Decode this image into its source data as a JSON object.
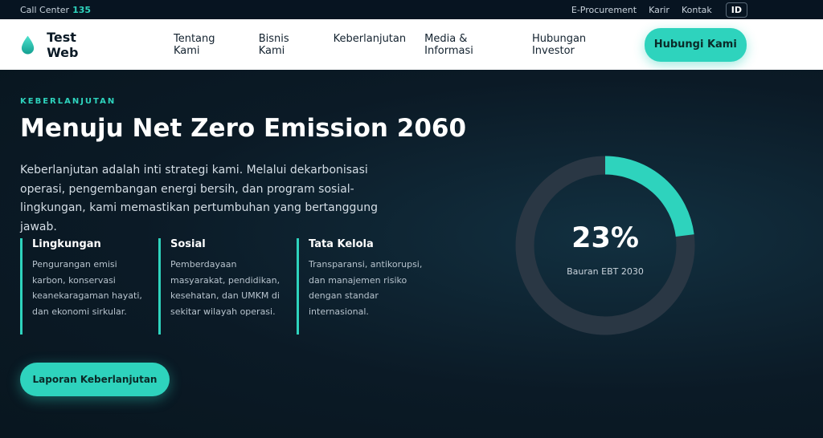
{
  "topbar": {
    "call_center_label": "Call Center",
    "call_center_number": "135",
    "links": [
      "E-Procurement",
      "Karir",
      "Kontak"
    ],
    "language": "ID"
  },
  "nav": {
    "brand": "Test Web",
    "menu": [
      "Tentang Kami",
      "Bisnis Kami",
      "Keberlanjutan",
      "Media & Informasi",
      "Hubungan Investor"
    ],
    "cta": "Hubungi Kami"
  },
  "hero": {
    "eyebrow": "KEBERLANJUTAN",
    "title": "Menuju Net Zero Emission 2060",
    "description": "Keberlanjutan adalah inti strategi kami. Melalui dekarbonisasi operasi, pengembangan energi bersih, dan program sosial-lingkungan, kami memastikan pertumbuhan yang bertanggung jawab.",
    "pillars": [
      {
        "title": "Lingkungan",
        "text": "Pengurangan emisi karbon, konservasi keanekaragaman hayati, dan ekonomi sirkular."
      },
      {
        "title": "Sosial",
        "text": "Pemberdayaan masyarakat, pendidikan, kesehatan, dan UMKM di sekitar wilayah operasi."
      },
      {
        "title": "Tata Kelola",
        "text": "Transparansi, antikorupsi, dan manajemen risiko dengan standar internasional."
      }
    ],
    "report_button": "Laporan Keberlanjutan"
  },
  "metric": {
    "value_label": "23%",
    "fraction": 0.23,
    "caption": "Bauran EBT 2030"
  },
  "colors": {
    "accent": "#2ed3bd",
    "background": "#0b1a26",
    "track": "#2a3744"
  }
}
